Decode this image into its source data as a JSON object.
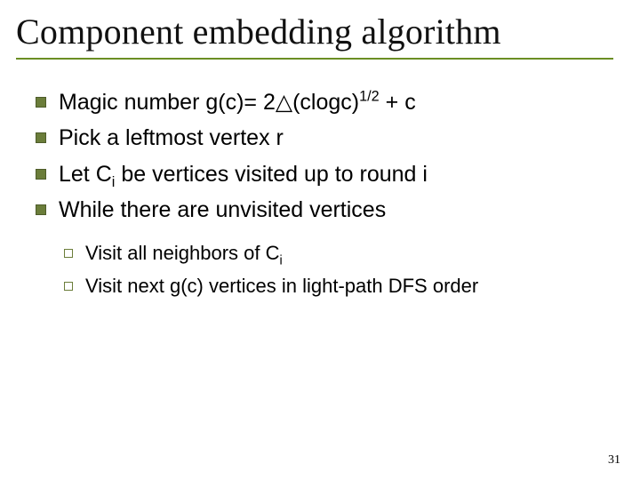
{
  "title": "Component embedding algorithm",
  "bullets": [
    {
      "pre": "Magic number g(c)= 2",
      "delta": "△",
      "mid": "(clogc)",
      "sup": "1/2",
      "post": " + c"
    },
    {
      "text": "Pick a leftmost vertex r"
    },
    {
      "pre": "Let C",
      "sub": "i",
      "post": " be vertices visited up to round i"
    },
    {
      "text": "While there are unvisited vertices"
    }
  ],
  "subbullets": [
    {
      "pre": "Visit all neighbors of C",
      "sub": "i",
      "post": ""
    },
    {
      "text": "Visit next g(c) vertices in light-path DFS order"
    }
  ],
  "pageNumber": "31"
}
